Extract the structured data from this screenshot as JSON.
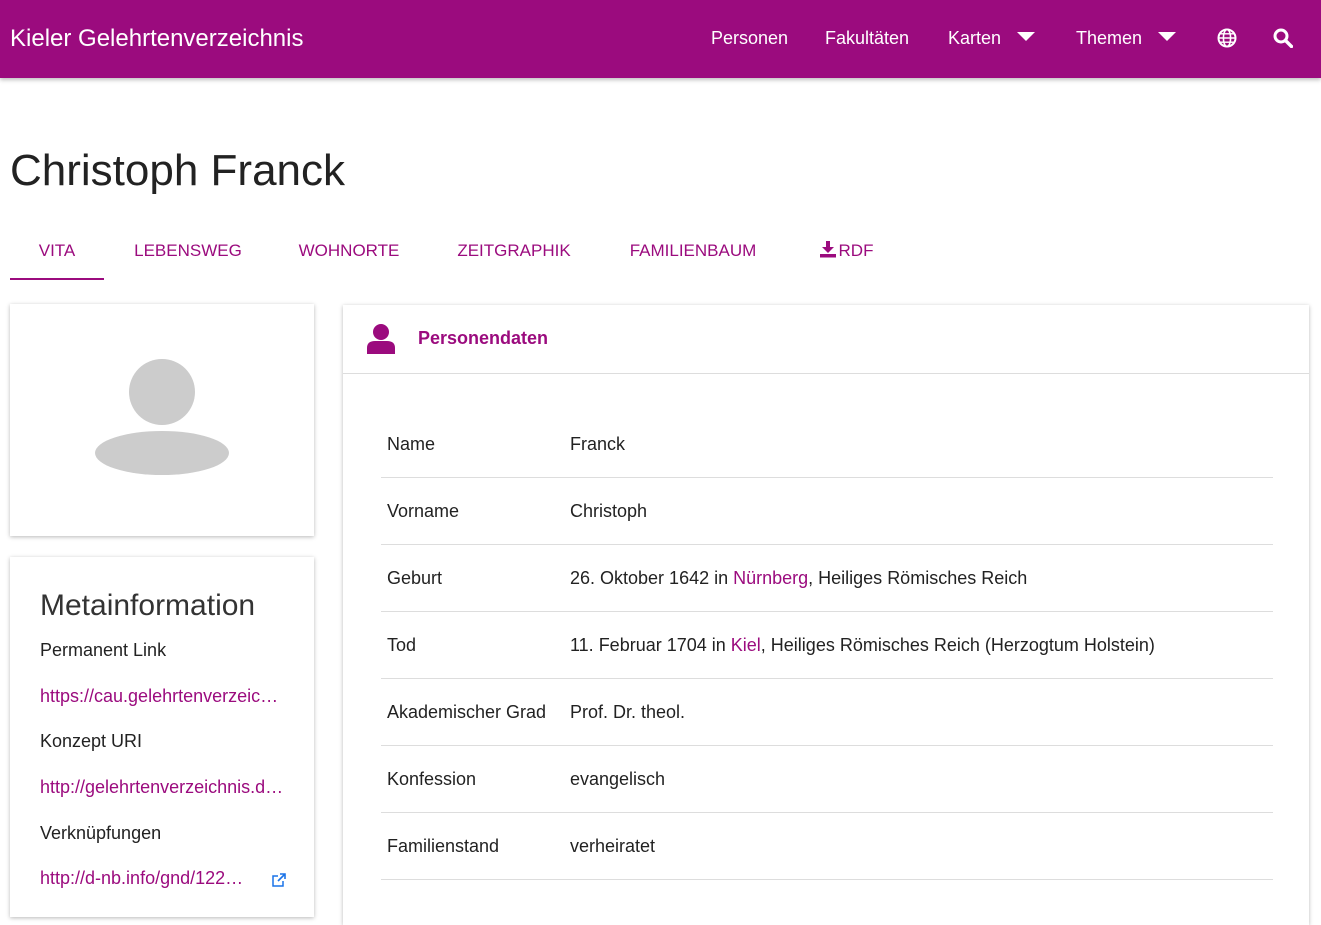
{
  "navbar": {
    "brand": "Kieler Gelehrtenverzeichnis",
    "items": [
      {
        "label": "Personen"
      },
      {
        "label": "Fakultäten"
      },
      {
        "label": "Karten"
      },
      {
        "label": "Themen"
      }
    ],
    "icons": [
      "globe-icon",
      "search-icon"
    ]
  },
  "page": {
    "title": "Christoph Franck"
  },
  "tabs": [
    {
      "label": "VITA",
      "active": true
    },
    {
      "label": "LEBENSWEG"
    },
    {
      "label": "WOHNORTE"
    },
    {
      "label": "ZEITGRAPHIK"
    },
    {
      "label": "FAMILIENBAUM"
    },
    {
      "label": "RDF",
      "icon": "download-icon"
    }
  ],
  "portrait": {
    "icon": "person-placeholder-icon"
  },
  "meta": {
    "title": "Metainformation",
    "permanent_link_label": "Permanent Link",
    "permanent_link": "https://cau.gelehrtenverzeichnis.de/person/…",
    "concept_uri_label": "Konzept URI",
    "concept_uri": "http://gelehrtenverzeichnis.de/person/…",
    "links_label": "Verknüpfungen",
    "gnd_link": "http://d-nb.info/gnd/122…"
  },
  "personendaten": {
    "title": "Personendaten",
    "rows": {
      "name": {
        "label": "Name",
        "value": "Franck"
      },
      "vorname": {
        "label": "Vorname",
        "value": "Christoph"
      },
      "geburt": {
        "label": "Geburt",
        "prefix": "26. Oktober 1642 in ",
        "place": "Nürnberg",
        "suffix": ", Heiliges Römisches Reich"
      },
      "tod": {
        "label": "Tod",
        "prefix": "11. Februar 1704 in ",
        "place": "Kiel",
        "suffix": ", Heiliges Römisches Reich (Herzogtum Holstein)"
      },
      "grad": {
        "label": "Akademischer Grad",
        "value": "Prof. Dr. theol."
      },
      "konfession": {
        "label": "Konfession",
        "value": "evangelisch"
      },
      "familienstand": {
        "label": "Familienstand",
        "value": "verheiratet"
      }
    }
  },
  "colors": {
    "accent": "#9b0b7e",
    "navbar": "#9b0b7e",
    "placeholder": "#cccccc",
    "link_icon": "#1a73e8"
  }
}
